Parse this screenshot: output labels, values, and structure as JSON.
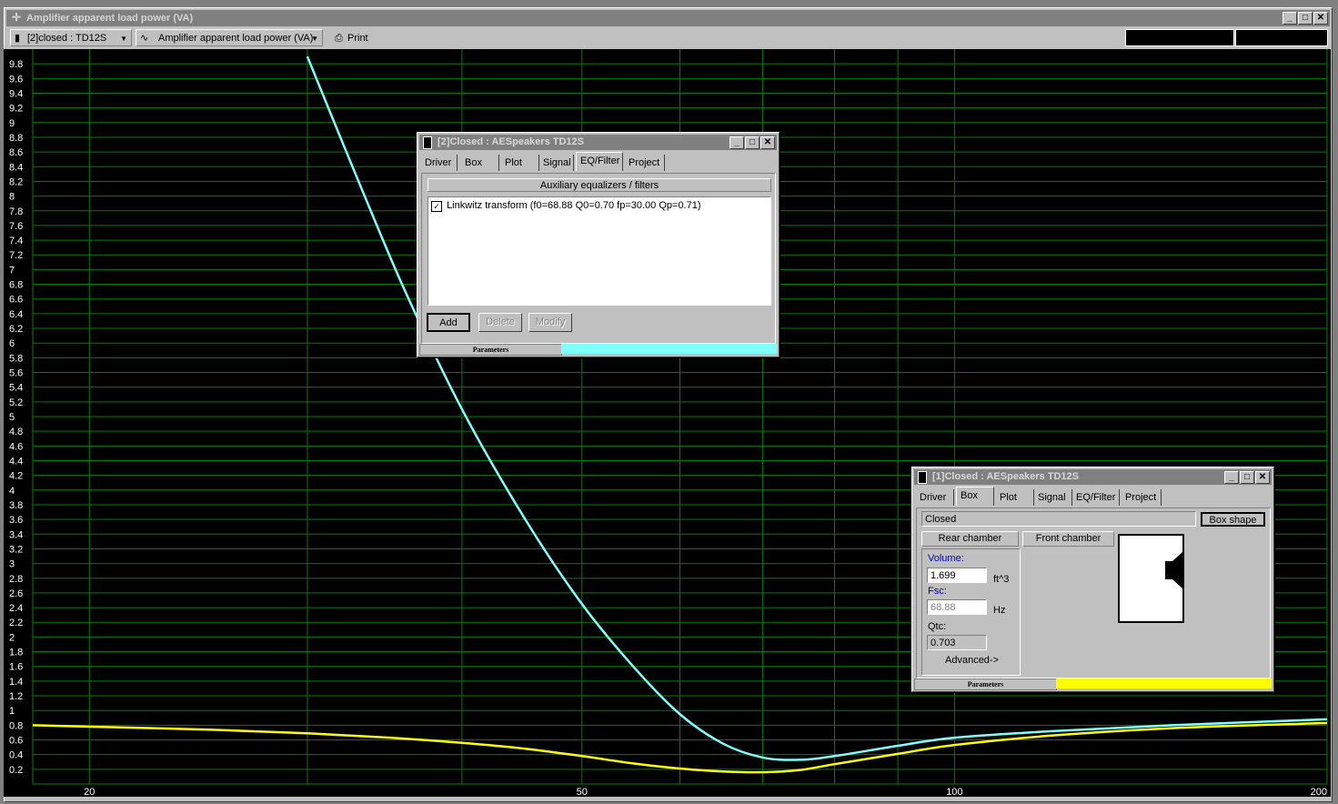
{
  "window": {
    "title": "Amplifier apparent load power (VA)",
    "toolbar": {
      "project_select": "[2]closed : TD12S",
      "plot_select": "Amplifier apparent load power (VA)",
      "print_label": "Print"
    }
  },
  "chart_data": {
    "type": "line",
    "xscale": "log",
    "xlim": [
      18,
      200
    ],
    "ylim": [
      0,
      10
    ],
    "grid": true,
    "x_tick_labels": [
      "20",
      "50",
      "100",
      "200"
    ],
    "y_tick_labels": [
      "9.8",
      "9.6",
      "9.4",
      "9.2",
      "9",
      "8.8",
      "8.6",
      "8.4",
      "8.2",
      "8",
      "7.8",
      "7.6",
      "7.4",
      "7.2",
      "7",
      "6.8",
      "6.6",
      "6.4",
      "6.2",
      "6",
      "5.8",
      "5.6",
      "5.4",
      "5.2",
      "5",
      "4.8",
      "4.6",
      "4.4",
      "4.2",
      "4",
      "3.8",
      "3.6",
      "3.4",
      "3.2",
      "3",
      "2.8",
      "2.6",
      "2.4",
      "2.2",
      "2",
      "1.8",
      "1.6",
      "1.4",
      "1.2",
      "1",
      "0.8",
      "0.6",
      "0.4",
      "0.2"
    ],
    "series": [
      {
        "color": "#80ffff",
        "x": [
          30,
          33,
          36,
          40,
          45,
          50,
          55,
          60,
          65,
          70,
          75,
          80,
          90,
          100,
          120,
          150,
          200
        ],
        "y": [
          9.9,
          8.2,
          6.7,
          5.1,
          3.6,
          2.45,
          1.6,
          0.95,
          0.55,
          0.36,
          0.33,
          0.38,
          0.52,
          0.63,
          0.72,
          0.8,
          0.88
        ]
      },
      {
        "color": "#ffff00",
        "x": [
          18,
          20,
          25,
          30,
          35,
          40,
          45,
          50,
          55,
          60,
          65,
          70,
          75,
          80,
          90,
          100,
          120,
          150,
          200
        ],
        "y": [
          0.8,
          0.78,
          0.74,
          0.69,
          0.63,
          0.56,
          0.48,
          0.38,
          0.28,
          0.21,
          0.17,
          0.16,
          0.19,
          0.27,
          0.41,
          0.53,
          0.66,
          0.76,
          0.83
        ]
      }
    ]
  },
  "dialog2": {
    "title": "[2]Closed : AESpeakers TD12S",
    "tabs": [
      "Driver",
      "Box",
      "Plot",
      "Signal",
      "EQ/Filter",
      "Project"
    ],
    "active_tab": "EQ/Filter",
    "section_header": "Auxiliary equalizers / filters",
    "list_items": [
      "Linkwitz transform (f0=68.88 Q0=0.70 fp=30.00 Qp=0.71)"
    ],
    "add_label": "Add",
    "delete_label": "Delete",
    "modify_label": "Modify",
    "status_label": "Parameters",
    "status_color": "#80ffff"
  },
  "dialog1": {
    "title": "[1]Closed : AESpeakers TD12S",
    "tabs": [
      "Driver",
      "Box",
      "Plot",
      "Signal",
      "EQ/Filter",
      "Project"
    ],
    "active_tab": "Box",
    "box_type": "Closed",
    "box_shape_label": "Box shape",
    "rear_chamber_label": "Rear chamber",
    "front_chamber_label": "Front chamber",
    "volume_label": "Volume:",
    "volume_value": "1.699",
    "volume_unit": "ft^3",
    "fsc_label": "Fsc:",
    "fsc_value": "68.88",
    "fsc_unit": "Hz",
    "qtc_label": "Qtc:",
    "qtc_value": "0.703",
    "advanced_label": "Advanced->",
    "status_label": "Parameters",
    "status_color": "#ffff00"
  }
}
